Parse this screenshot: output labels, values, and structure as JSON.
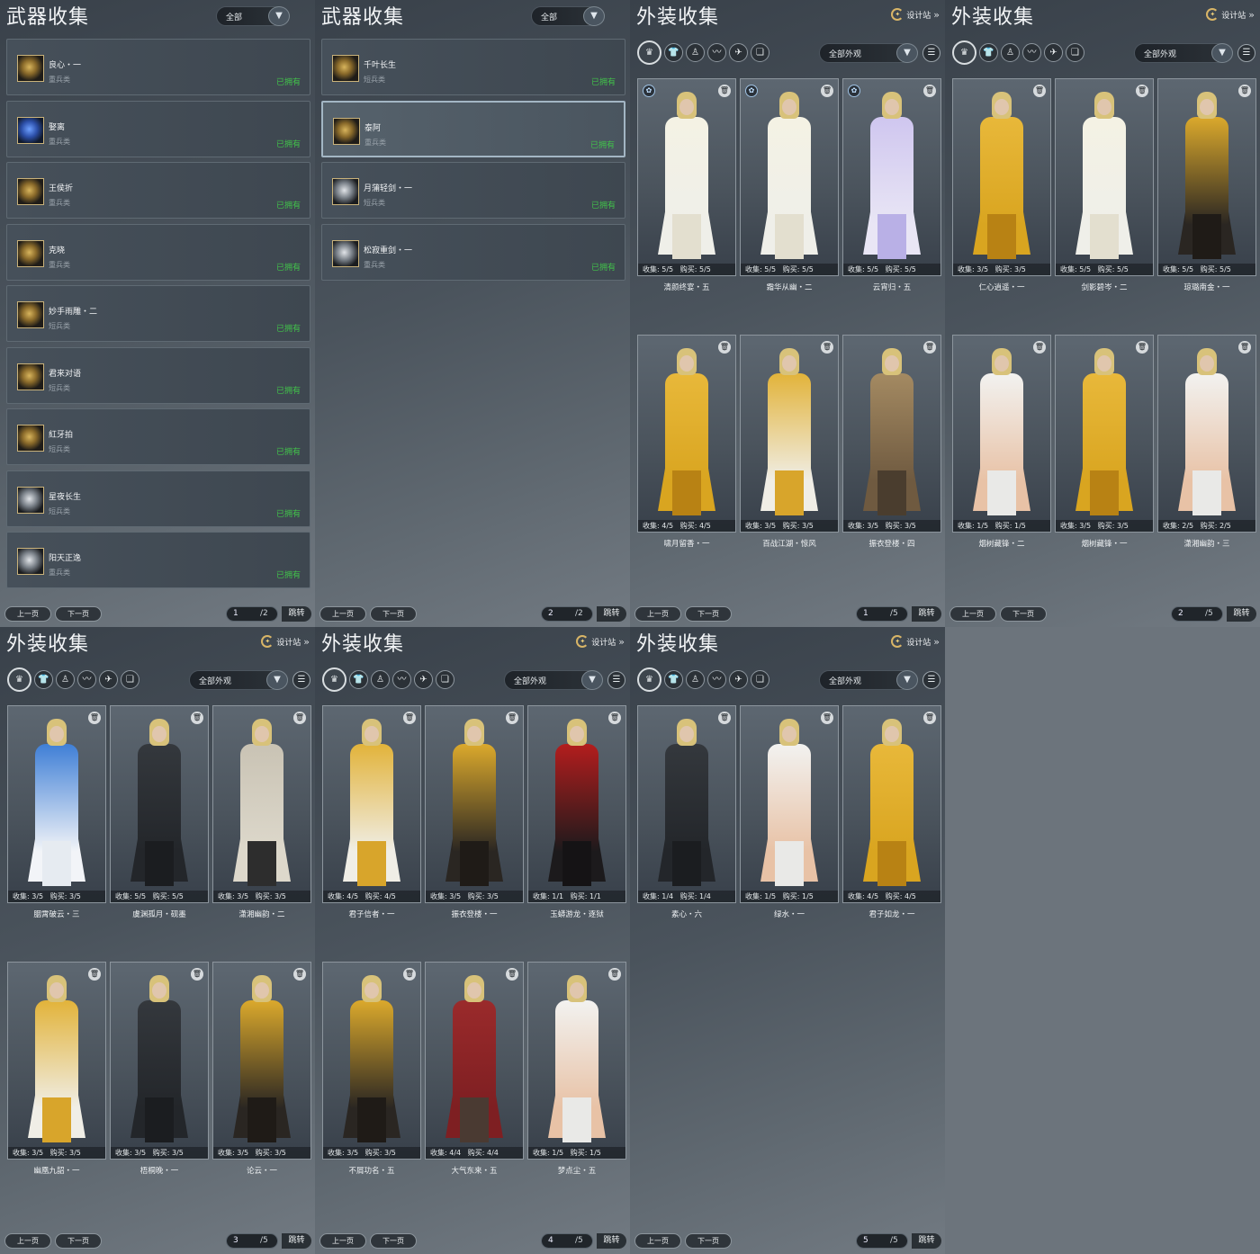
{
  "colors": {
    "owned": "#41c24a",
    "panel": "#4a535c"
  },
  "weapons_p1": {
    "title": "武器收集",
    "filter": "全部",
    "items": [
      {
        "name": "良心・一",
        "type": "重兵类",
        "status": "已拥有",
        "icon": "gold"
      },
      {
        "name": "娶离",
        "type": "重兵类",
        "status": "已拥有",
        "icon": "blue"
      },
      {
        "name": "王侯折",
        "type": "重兵类",
        "status": "已拥有",
        "icon": "gold"
      },
      {
        "name": "克晓",
        "type": "重兵类",
        "status": "已拥有",
        "icon": "gold"
      },
      {
        "name": "妙手雨雕・二",
        "type": "短兵类",
        "status": "已拥有",
        "icon": "gold"
      },
      {
        "name": "君来对语",
        "type": "短兵类",
        "status": "已拥有",
        "icon": "gold"
      },
      {
        "name": "紅牙拍",
        "type": "短兵类",
        "status": "已拥有",
        "icon": "gold"
      },
      {
        "name": "星夜长生",
        "type": "短兵类",
        "status": "已拥有",
        "icon": "steel"
      },
      {
        "name": "阳天正逸",
        "type": "重兵类",
        "status": "已拥有",
        "icon": "steel"
      }
    ],
    "prev": "上一页",
    "next": "下一页",
    "page": "1",
    "total": "/2",
    "jump": "跳转"
  },
  "weapons_p2": {
    "title": "武器收集",
    "filter": "全部",
    "items": [
      {
        "name": "千叶长生",
        "type": "短兵类",
        "status": "已拥有",
        "icon": "gold"
      },
      {
        "name": "泰阿",
        "type": "重兵类",
        "status": "已拥有",
        "icon": "gold"
      },
      {
        "name": "月蒲轻剑・一",
        "type": "短兵类",
        "status": "已拥有",
        "icon": "steel"
      },
      {
        "name": "松寂重剑・一",
        "type": "重兵类",
        "status": "已拥有",
        "icon": "steel"
      }
    ],
    "prev": "上一页",
    "next": "下一页",
    "page": "2",
    "total": "/2",
    "jump": "跳转"
  },
  "outfit_common": {
    "title": "外装收集",
    "design": "设计站",
    "filter": "全部外观",
    "prev": "上一页",
    "next": "下一页",
    "total": "/5",
    "jump": "跳转",
    "collect_label": "收集:",
    "buy_label": "购买:"
  },
  "outfit_pages": [
    {
      "page": "1",
      "cards": [
        {
          "name": "清颜终宴・五",
          "collect": "5/5",
          "buy": "5/5",
          "gift": true,
          "palette": "white"
        },
        {
          "name": "霜华从幽・二",
          "collect": "5/5",
          "buy": "5/5",
          "gift": true,
          "palette": "white"
        },
        {
          "name": "云宵归・五",
          "collect": "5/5",
          "buy": "5/5",
          "gift": true,
          "palette": "lilac"
        },
        {
          "name": "啸月留香・一",
          "collect": "4/5",
          "buy": "4/5",
          "gift": false,
          "palette": "gold"
        },
        {
          "name": "百战江湖・惊风",
          "collect": "3/5",
          "buy": "3/5",
          "gift": false,
          "palette": "whitegold"
        },
        {
          "name": "振衣登楼・四",
          "collect": "3/5",
          "buy": "3/5",
          "gift": false,
          "palette": "brown"
        }
      ]
    },
    {
      "page": "2",
      "cards": [
        {
          "name": "仁心逍遥・一",
          "collect": "3/5",
          "buy": "3/5",
          "gift": false,
          "palette": "gold"
        },
        {
          "name": "剑影碧岑・二",
          "collect": "5/5",
          "buy": "5/5",
          "gift": false,
          "palette": "white"
        },
        {
          "name": "琼璐南金・一",
          "collect": "5/5",
          "buy": "5/5",
          "gift": false,
          "palette": "goldblack"
        },
        {
          "name": "烟树藏锋・二",
          "collect": "1/5",
          "buy": "1/5",
          "gift": false,
          "palette": "bare"
        },
        {
          "name": "烟树藏锋・一",
          "collect": "3/5",
          "buy": "3/5",
          "gift": false,
          "palette": "gold"
        },
        {
          "name": "潇湘幽韵・三",
          "collect": "2/5",
          "buy": "2/5",
          "gift": false,
          "palette": "bare"
        }
      ]
    },
    {
      "page": "3",
      "cards": [
        {
          "name": "胭霄破云・三",
          "collect": "3/5",
          "buy": "3/5",
          "gift": false,
          "palette": "blue"
        },
        {
          "name": "虞渊孤月・砚墨",
          "collect": "5/5",
          "buy": "5/5",
          "gift": false,
          "palette": "black"
        },
        {
          "name": "潇湘幽韵・二",
          "collect": "3/5",
          "buy": "3/5",
          "gift": false,
          "palette": "grey"
        },
        {
          "name": "幽凰九韶・一",
          "collect": "3/5",
          "buy": "3/5",
          "gift": false,
          "palette": "whitegold"
        },
        {
          "name": "梧桐晚・一",
          "collect": "3/5",
          "buy": "3/5",
          "gift": false,
          "palette": "black"
        },
        {
          "name": "论云・一",
          "collect": "3/5",
          "buy": "3/5",
          "gift": false,
          "palette": "goldblack"
        }
      ]
    },
    {
      "page": "4",
      "cards": [
        {
          "name": "君子信者・一",
          "collect": "4/5",
          "buy": "4/5",
          "gift": false,
          "palette": "whitegold"
        },
        {
          "name": "振衣登楼・一",
          "collect": "3/5",
          "buy": "3/5",
          "gift": false,
          "palette": "goldblack"
        },
        {
          "name": "玉蟒游龙・逐狱",
          "collect": "1/1",
          "buy": "1/1",
          "gift": false,
          "palette": "red"
        },
        {
          "name": "不屑功名・五",
          "collect": "3/5",
          "buy": "3/5",
          "gift": false,
          "palette": "goldblack"
        },
        {
          "name": "大气东来・五",
          "collect": "4/4",
          "buy": "4/4",
          "gift": false,
          "palette": "crimson"
        },
        {
          "name": "梦点尘・五",
          "collect": "1/5",
          "buy": "1/5",
          "gift": false,
          "palette": "bare"
        }
      ]
    },
    {
      "page": "5",
      "cards": [
        {
          "name": "素心・六",
          "collect": "1/4",
          "buy": "1/4",
          "gift": false,
          "palette": "black"
        },
        {
          "name": "绿水・一",
          "collect": "1/5",
          "buy": "1/5",
          "gift": false,
          "palette": "bare"
        },
        {
          "name": "君子如龙・一",
          "collect": "4/5",
          "buy": "4/5",
          "gift": false,
          "palette": "gold"
        }
      ]
    }
  ]
}
